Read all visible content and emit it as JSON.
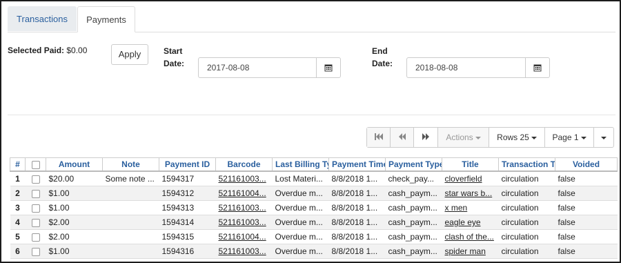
{
  "tabs": [
    {
      "label": "Transactions",
      "active": false
    },
    {
      "label": "Payments",
      "active": true
    }
  ],
  "filters": {
    "selected_paid_label": "Selected Paid:",
    "selected_paid_value": "$0.00",
    "apply_label": "Apply",
    "start_date_label_1": "Start",
    "start_date_label_2": "Date:",
    "start_date_value": "2017-08-08",
    "end_date_label_1": "End",
    "end_date_label_2": "Date:",
    "end_date_value": "2018-08-08"
  },
  "toolbar": {
    "first_icon": "first-page-icon",
    "prev_icon": "previous-page-icon",
    "next_icon": "next-page-icon",
    "actions_label": "Actions",
    "rows_label": "Rows 25",
    "page_label": "Page 1"
  },
  "table": {
    "columns": [
      "#",
      "",
      "Amount",
      "Note",
      "Payment ID",
      "Barcode",
      "Last Billing Ty",
      "Payment Time",
      "Payment Type",
      "Title",
      "Transaction T",
      "Voided"
    ],
    "rows": [
      {
        "num": "1",
        "amount": "$20.00",
        "note": "Some note ...",
        "payment_id": "1594317",
        "barcode": "521161003...",
        "billing": "Lost Materi...",
        "time": "8/8/2018 1...",
        "type": "check_pay...",
        "title": "cloverfield",
        "txn": "circulation",
        "voided": "false"
      },
      {
        "num": "2",
        "amount": "$1.00",
        "note": "",
        "payment_id": "1594312",
        "barcode": "521161004...",
        "billing": "Overdue m...",
        "time": "8/8/2018 1...",
        "type": "cash_paym...",
        "title": "star wars b...",
        "txn": "circulation",
        "voided": "false"
      },
      {
        "num": "3",
        "amount": "$1.00",
        "note": "",
        "payment_id": "1594313",
        "barcode": "521161003...",
        "billing": "Overdue m...",
        "time": "8/8/2018 1...",
        "type": "cash_paym...",
        "title": "x men",
        "txn": "circulation",
        "voided": "false"
      },
      {
        "num": "4",
        "amount": "$2.00",
        "note": "",
        "payment_id": "1594314",
        "barcode": "521161003...",
        "billing": "Overdue m...",
        "time": "8/8/2018 1...",
        "type": "cash_paym...",
        "title": "eagle eye",
        "txn": "circulation",
        "voided": "false"
      },
      {
        "num": "5",
        "amount": "$2.00",
        "note": "",
        "payment_id": "1594315",
        "barcode": "521161004...",
        "billing": "Overdue m...",
        "time": "8/8/2018 1...",
        "type": "cash_paym...",
        "title": "clash of the...",
        "txn": "circulation",
        "voided": "false"
      },
      {
        "num": "6",
        "amount": "$1.00",
        "note": "",
        "payment_id": "1594316",
        "barcode": "521161003...",
        "billing": "Overdue m...",
        "time": "8/8/2018 1...",
        "type": "cash_paym...",
        "title": "spider man",
        "txn": "circulation",
        "voided": "false"
      }
    ]
  },
  "colors": {
    "accent": "#2a5f9e",
    "row_alt": "#f2f2f2",
    "border": "#cccccc"
  }
}
